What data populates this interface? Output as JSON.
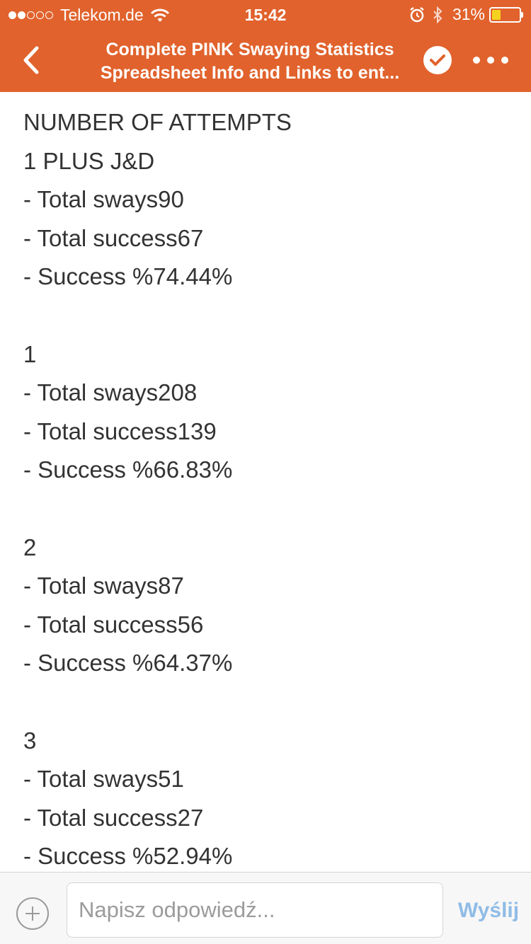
{
  "status_bar": {
    "carrier": "Telekom.de",
    "time": "15:42",
    "battery_percent": "31%",
    "battery_level": 0.31,
    "signal_bars": 2
  },
  "nav": {
    "title_line1": "Complete PINK Swaying Statistics",
    "title_line2": "Spreadsheet Info and Links to ent..."
  },
  "content": {
    "lines": [
      "NUMBER OF ATTEMPTS",
      "1 PLUS J&D",
      "- Total sways90",
      "- Total success67",
      "- Success %74.44%",
      "",
      "1",
      "- Total sways208",
      "- Total success139",
      "- Success %66.83%",
      "",
      "2",
      "- Total sways87",
      "- Total success56",
      "- Success %64.37%",
      "",
      "3",
      "- Total sways51",
      "- Total success27",
      "- Success %52.94%"
    ]
  },
  "reply": {
    "placeholder": "Napisz odpowiedź...",
    "send_label": "Wyślij"
  },
  "colors": {
    "header": "#e1622c",
    "text": "#333333",
    "send": "#8fbce6",
    "battery_fill": "#f5d21f"
  }
}
